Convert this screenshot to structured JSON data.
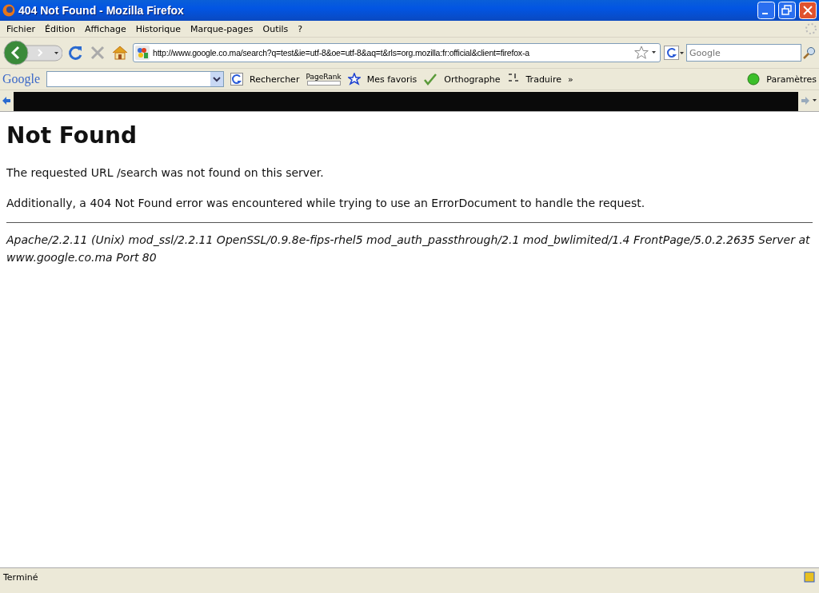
{
  "window": {
    "title": "404 Not Found - Mozilla Firefox"
  },
  "menu": [
    "Fichier",
    "Édition",
    "Affichage",
    "Historique",
    "Marque-pages",
    "Outils",
    "?"
  ],
  "navigation": {
    "url": "http://www.google.co.ma/search?q=test&ie=utf-8&oe=utf-8&aq=t&rls=org.mozilla:fr:official&client=firefox-a",
    "search_placeholder": "Google"
  },
  "google_toolbar": {
    "logo": "Google",
    "items": [
      {
        "kind": "search",
        "label": "Rechercher"
      },
      {
        "kind": "pagerank",
        "label": "PageRank"
      },
      {
        "kind": "favorites",
        "label": "Mes favoris"
      },
      {
        "kind": "spell",
        "label": "Orthographe"
      },
      {
        "kind": "translate",
        "label": "Traduire"
      },
      {
        "kind": "more",
        "label": "»"
      },
      {
        "kind": "settings",
        "label": "Paramètres"
      }
    ]
  },
  "page": {
    "heading": "Not Found",
    "paragraphs": [
      "The requested URL /search was not found on this server.",
      "Additionally, a 404 Not Found error was encountered while trying to use an ErrorDocument to handle the request."
    ],
    "address": "Apache/2.2.11 (Unix) mod_ssl/2.2.11 OpenSSL/0.9.8e-fips-rhel5 mod_auth_passthrough/2.1 mod_bwlimited/1.4 FrontPage/5.0.2.2635 Server at www.google.co.ma Port 80"
  },
  "status_bar": {
    "text": "Terminé"
  }
}
